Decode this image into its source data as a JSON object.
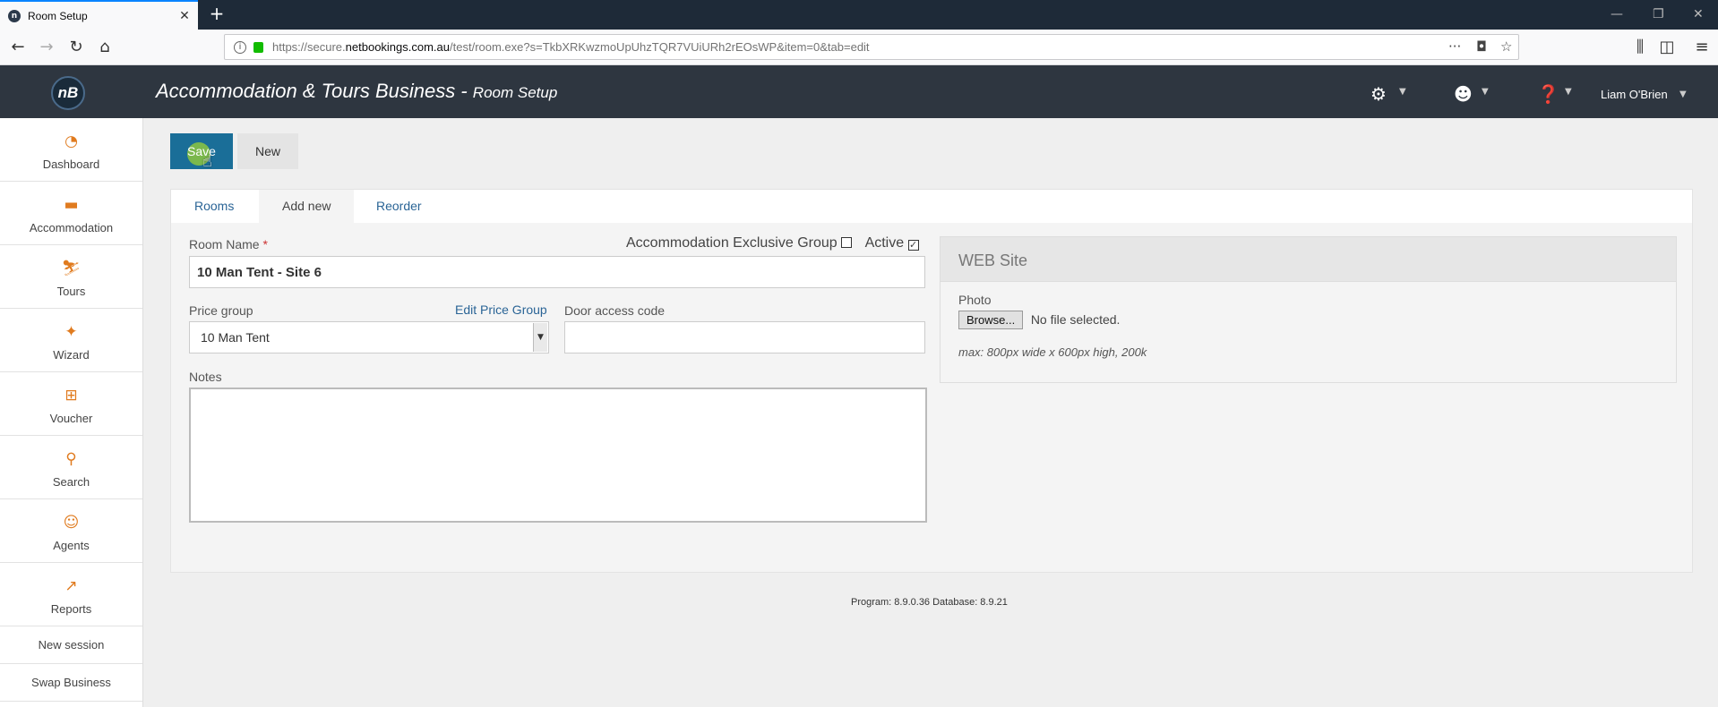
{
  "browser": {
    "tab_title": "Room Setup",
    "favicon_text": "n",
    "url_prefix": "https://secure.",
    "url_domain": "netbookings.com.au",
    "url_rest": "/test/room.exe?s=TkbXRKwzmoUpUhzTQR7VUiURh2rEOsWP&item=0&tab=edit"
  },
  "app": {
    "logo_text": "nB",
    "title": "Accommodation & Tours Business",
    "title_sep": " - ",
    "subtitle": "Room Setup",
    "user_name": "Liam O'Brien"
  },
  "sidebar": {
    "items": [
      {
        "label": "Dashboard",
        "icon": "speedometer-icon"
      },
      {
        "label": "Accommodation",
        "icon": "bed-icon"
      },
      {
        "label": "Tours",
        "icon": "tours-icon"
      },
      {
        "label": "Wizard",
        "icon": "magic-wand-icon"
      },
      {
        "label": "Voucher",
        "icon": "gift-icon"
      },
      {
        "label": "Search",
        "icon": "search-icon"
      },
      {
        "label": "Agents",
        "icon": "agent-icon"
      },
      {
        "label": "Reports",
        "icon": "chart-icon"
      }
    ],
    "links": [
      "New session",
      "Swap Business"
    ]
  },
  "toolbar": {
    "save_label": "Save",
    "new_label": "New"
  },
  "tabs": [
    "Rooms",
    "Add new",
    "Reorder"
  ],
  "form": {
    "room_name_label": "Room Name",
    "required_mark": "*",
    "room_name_value": "10 Man Tent - Site 6",
    "exclusive_group_label": "Accommodation Exclusive Group",
    "exclusive_group_checked": false,
    "active_label": "Active",
    "active_checked": true,
    "price_group_label": "Price group",
    "edit_price_group_label": "Edit Price Group",
    "price_group_value": "10 Man Tent",
    "door_code_label": "Door access code",
    "door_code_value": "",
    "notes_label": "Notes",
    "notes_value": ""
  },
  "web": {
    "title": "WEB Site",
    "photo_label": "Photo",
    "browse_label": "Browse...",
    "file_status": "No file selected.",
    "hint": "max: 800px wide x 600px high, 200k"
  },
  "footer": {
    "version": "Program: 8.9.0.36 Database: 8.9.21"
  },
  "colors": {
    "header_bg": "#2e3640",
    "save_button": "#1a6e98",
    "accent_icon": "#e07b1f",
    "link": "#2a6496"
  }
}
